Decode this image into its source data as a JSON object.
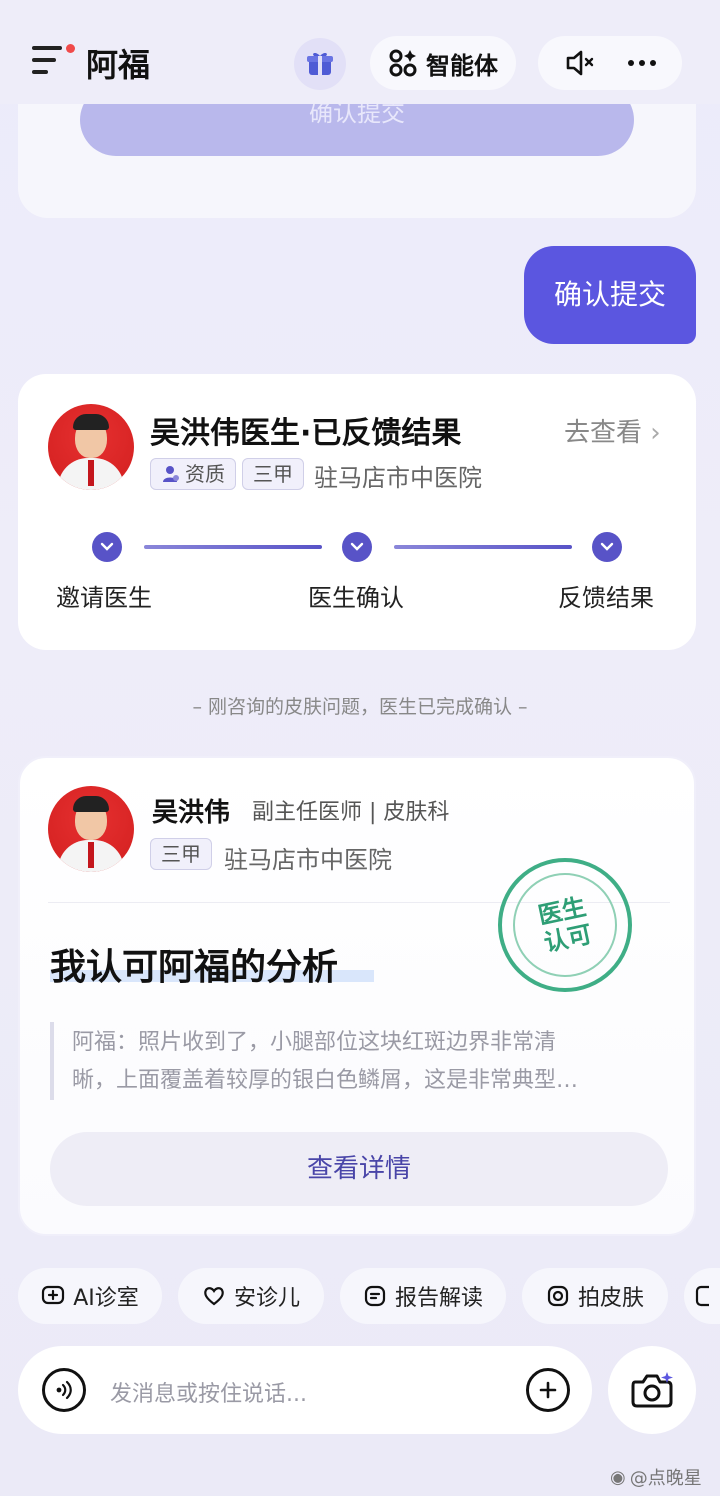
{
  "header": {
    "app_title": "阿福",
    "agent_button_label": "智能体",
    "icons": [
      "menu-icon",
      "gift-icon",
      "agent-grid-icon",
      "mute-icon",
      "more-icon"
    ]
  },
  "previous_card": {
    "button_label": "确认提交"
  },
  "user_message": "确认提交",
  "feedback_card": {
    "title": "吴洪伟医生·已反馈结果",
    "view_link": "去查看",
    "tag_qualification": "资质",
    "tag_level": "三甲",
    "hospital": "驻马店市中医院",
    "steps": [
      "邀请医生",
      "医生确认",
      "反馈结果"
    ]
  },
  "divider_text": "–  刚咨询的皮肤问题，医生已完成确认  –",
  "doctor_card": {
    "name": "吴洪伟",
    "title": "副主任医师 | 皮肤科",
    "tag_level": "三甲",
    "hospital": "驻马店市中医院",
    "headline": "我认可阿福的分析",
    "stamp_line1": "医生",
    "stamp_line2": "认可",
    "quote_line1": "阿福：照片收到了，小腿部位这块红斑边界非常清",
    "quote_line2": "晰，上面覆盖着较厚的银白色鳞屑，这是非常典型…",
    "detail_button": "查看详情"
  },
  "quick_actions": [
    {
      "label": "AI诊室",
      "icon": "chat-plus-icon"
    },
    {
      "label": "安诊儿",
      "icon": "heart-hand-icon"
    },
    {
      "label": "报告解读",
      "icon": "report-icon"
    },
    {
      "label": "拍皮肤",
      "icon": "camera-circle-icon"
    }
  ],
  "input": {
    "placeholder": "发消息或按住说话..."
  },
  "watermark": "@点晚星",
  "colors": {
    "accent": "#5b56e0",
    "step": "#5853c7",
    "stamp": "#3fae86",
    "background": "#eeedf9"
  }
}
